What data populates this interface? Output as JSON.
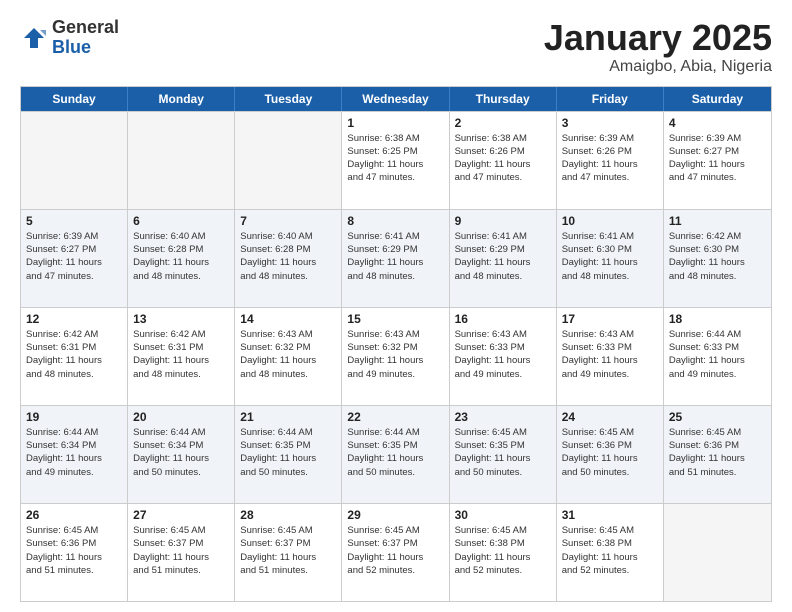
{
  "header": {
    "logo": {
      "general": "General",
      "blue": "Blue"
    },
    "title": "January 2025",
    "subtitle": "Amaigbo, Abia, Nigeria"
  },
  "days_of_week": [
    "Sunday",
    "Monday",
    "Tuesday",
    "Wednesday",
    "Thursday",
    "Friday",
    "Saturday"
  ],
  "weeks": [
    [
      {
        "day": "",
        "info": ""
      },
      {
        "day": "",
        "info": ""
      },
      {
        "day": "",
        "info": ""
      },
      {
        "day": "1",
        "info": "Sunrise: 6:38 AM\nSunset: 6:25 PM\nDaylight: 11 hours\nand 47 minutes."
      },
      {
        "day": "2",
        "info": "Sunrise: 6:38 AM\nSunset: 6:26 PM\nDaylight: 11 hours\nand 47 minutes."
      },
      {
        "day": "3",
        "info": "Sunrise: 6:39 AM\nSunset: 6:26 PM\nDaylight: 11 hours\nand 47 minutes."
      },
      {
        "day": "4",
        "info": "Sunrise: 6:39 AM\nSunset: 6:27 PM\nDaylight: 11 hours\nand 47 minutes."
      }
    ],
    [
      {
        "day": "5",
        "info": "Sunrise: 6:39 AM\nSunset: 6:27 PM\nDaylight: 11 hours\nand 47 minutes."
      },
      {
        "day": "6",
        "info": "Sunrise: 6:40 AM\nSunset: 6:28 PM\nDaylight: 11 hours\nand 48 minutes."
      },
      {
        "day": "7",
        "info": "Sunrise: 6:40 AM\nSunset: 6:28 PM\nDaylight: 11 hours\nand 48 minutes."
      },
      {
        "day": "8",
        "info": "Sunrise: 6:41 AM\nSunset: 6:29 PM\nDaylight: 11 hours\nand 48 minutes."
      },
      {
        "day": "9",
        "info": "Sunrise: 6:41 AM\nSunset: 6:29 PM\nDaylight: 11 hours\nand 48 minutes."
      },
      {
        "day": "10",
        "info": "Sunrise: 6:41 AM\nSunset: 6:30 PM\nDaylight: 11 hours\nand 48 minutes."
      },
      {
        "day": "11",
        "info": "Sunrise: 6:42 AM\nSunset: 6:30 PM\nDaylight: 11 hours\nand 48 minutes."
      }
    ],
    [
      {
        "day": "12",
        "info": "Sunrise: 6:42 AM\nSunset: 6:31 PM\nDaylight: 11 hours\nand 48 minutes."
      },
      {
        "day": "13",
        "info": "Sunrise: 6:42 AM\nSunset: 6:31 PM\nDaylight: 11 hours\nand 48 minutes."
      },
      {
        "day": "14",
        "info": "Sunrise: 6:43 AM\nSunset: 6:32 PM\nDaylight: 11 hours\nand 48 minutes."
      },
      {
        "day": "15",
        "info": "Sunrise: 6:43 AM\nSunset: 6:32 PM\nDaylight: 11 hours\nand 49 minutes."
      },
      {
        "day": "16",
        "info": "Sunrise: 6:43 AM\nSunset: 6:33 PM\nDaylight: 11 hours\nand 49 minutes."
      },
      {
        "day": "17",
        "info": "Sunrise: 6:43 AM\nSunset: 6:33 PM\nDaylight: 11 hours\nand 49 minutes."
      },
      {
        "day": "18",
        "info": "Sunrise: 6:44 AM\nSunset: 6:33 PM\nDaylight: 11 hours\nand 49 minutes."
      }
    ],
    [
      {
        "day": "19",
        "info": "Sunrise: 6:44 AM\nSunset: 6:34 PM\nDaylight: 11 hours\nand 49 minutes."
      },
      {
        "day": "20",
        "info": "Sunrise: 6:44 AM\nSunset: 6:34 PM\nDaylight: 11 hours\nand 50 minutes."
      },
      {
        "day": "21",
        "info": "Sunrise: 6:44 AM\nSunset: 6:35 PM\nDaylight: 11 hours\nand 50 minutes."
      },
      {
        "day": "22",
        "info": "Sunrise: 6:44 AM\nSunset: 6:35 PM\nDaylight: 11 hours\nand 50 minutes."
      },
      {
        "day": "23",
        "info": "Sunrise: 6:45 AM\nSunset: 6:35 PM\nDaylight: 11 hours\nand 50 minutes."
      },
      {
        "day": "24",
        "info": "Sunrise: 6:45 AM\nSunset: 6:36 PM\nDaylight: 11 hours\nand 50 minutes."
      },
      {
        "day": "25",
        "info": "Sunrise: 6:45 AM\nSunset: 6:36 PM\nDaylight: 11 hours\nand 51 minutes."
      }
    ],
    [
      {
        "day": "26",
        "info": "Sunrise: 6:45 AM\nSunset: 6:36 PM\nDaylight: 11 hours\nand 51 minutes."
      },
      {
        "day": "27",
        "info": "Sunrise: 6:45 AM\nSunset: 6:37 PM\nDaylight: 11 hours\nand 51 minutes."
      },
      {
        "day": "28",
        "info": "Sunrise: 6:45 AM\nSunset: 6:37 PM\nDaylight: 11 hours\nand 51 minutes."
      },
      {
        "day": "29",
        "info": "Sunrise: 6:45 AM\nSunset: 6:37 PM\nDaylight: 11 hours\nand 52 minutes."
      },
      {
        "day": "30",
        "info": "Sunrise: 6:45 AM\nSunset: 6:38 PM\nDaylight: 11 hours\nand 52 minutes."
      },
      {
        "day": "31",
        "info": "Sunrise: 6:45 AM\nSunset: 6:38 PM\nDaylight: 11 hours\nand 52 minutes."
      },
      {
        "day": "",
        "info": ""
      }
    ]
  ],
  "alt_rows": [
    1,
    3
  ]
}
